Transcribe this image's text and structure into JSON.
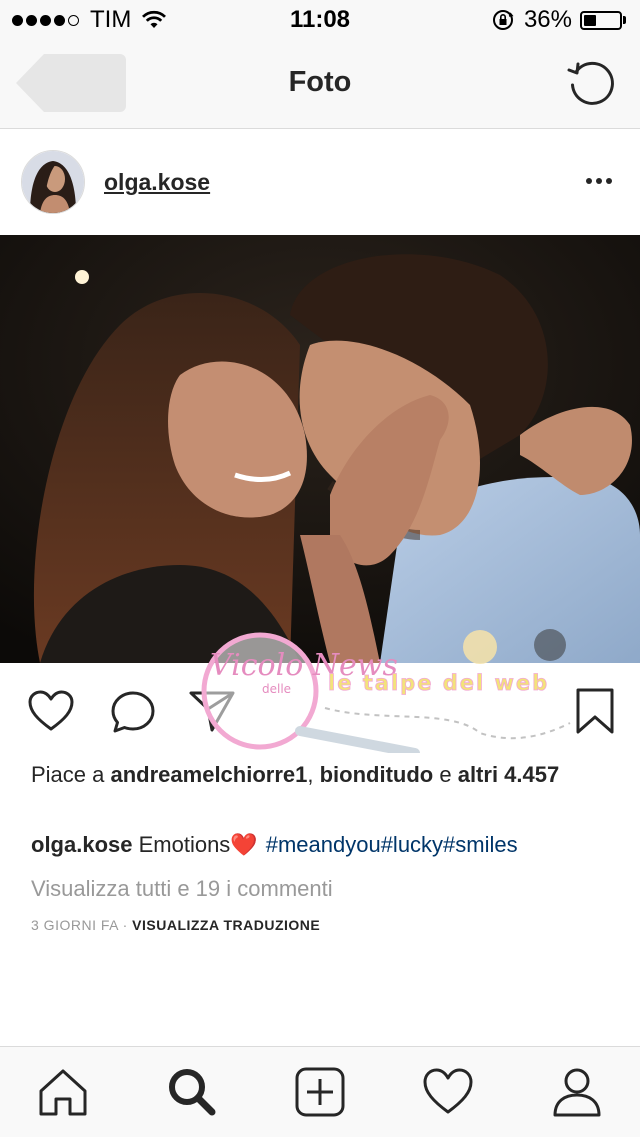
{
  "status_bar": {
    "carrier": "TIM",
    "time": "11:08",
    "battery_percent": "36%",
    "battery_level": 0.36,
    "signal_bars_filled": 4,
    "signal_bars_total": 5
  },
  "nav": {
    "title": "Foto",
    "back_icon": "back-button-blurred",
    "refresh_icon": "refresh-icon"
  },
  "post": {
    "username": "olga.kose",
    "likes_prefix": "Piace a ",
    "liker_1": "andreamelchiorre1",
    "liker_sep": ", ",
    "liker_2": "bionditudo",
    "liker_and": " e ",
    "liker_more": "altri 4.457",
    "caption_user": "olga.kose",
    "caption_text": " Emotions",
    "caption_emoji": "❤️",
    "caption_tags": "#meandyou#lucky#smiles",
    "view_comments": "Visualizza tutti e 19 i commenti",
    "time_ago": "3 GIORNI FA",
    "meta_sep": " · ",
    "translate": "VISUALIZZA TRADUZIONE"
  },
  "watermark": {
    "logo_text": "Vicolo News",
    "logo_sub": "delle",
    "banner_text": "le talpe del web"
  },
  "tab_bar": {
    "items": [
      "home-icon",
      "search-icon",
      "add-post-icon",
      "activity-heart-icon",
      "profile-icon"
    ],
    "active": "search-icon"
  },
  "colors": {
    "text": "#262626",
    "muted": "#999999",
    "hashtag": "#003569",
    "bar_bg": "#f8f8f8"
  }
}
